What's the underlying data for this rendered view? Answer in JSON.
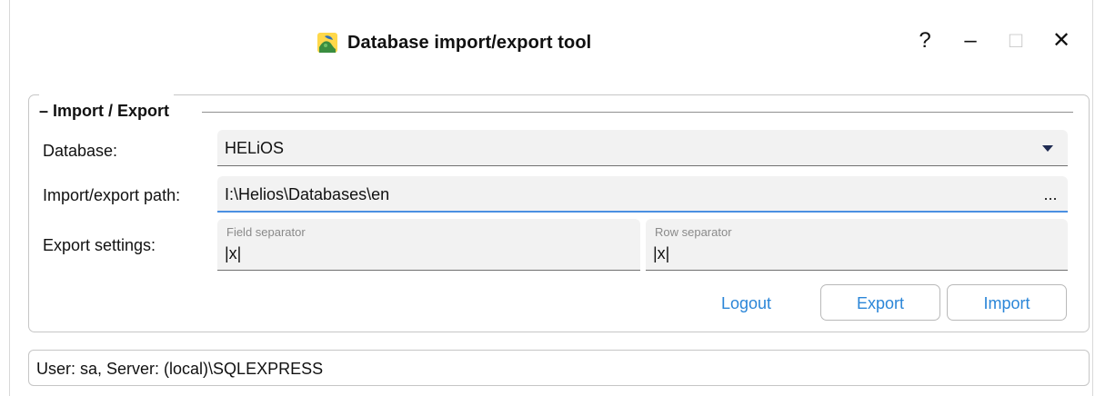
{
  "window": {
    "title": "Database import/export tool",
    "controls": {
      "help": "?",
      "minimize": "–",
      "maximize": "□",
      "close": "✕"
    }
  },
  "import_export": {
    "group_title": "Import / Export",
    "database": {
      "label": "Database:",
      "value": "HELiOS"
    },
    "path": {
      "label": "Import/export path:",
      "value": "I:\\Helios\\Databases\\en",
      "browse_label": "..."
    },
    "export_settings": {
      "label": "Export settings:",
      "field_separator": {
        "label": "Field separator",
        "value": "|x|"
      },
      "row_separator": {
        "label": "Row separator",
        "value": "|x|"
      }
    },
    "actions": {
      "logout": "Logout",
      "export": "Export",
      "import": "Import"
    }
  },
  "status": {
    "text": "User: sa, Server: (local)\\SQLEXPRESS"
  },
  "colors": {
    "accent": "#2b86d8",
    "focus_border": "#4a90e2",
    "field_background": "#f2f2f2"
  },
  "icons": {
    "app": "database-app-icon",
    "dropdown": "chevron-down-icon"
  }
}
